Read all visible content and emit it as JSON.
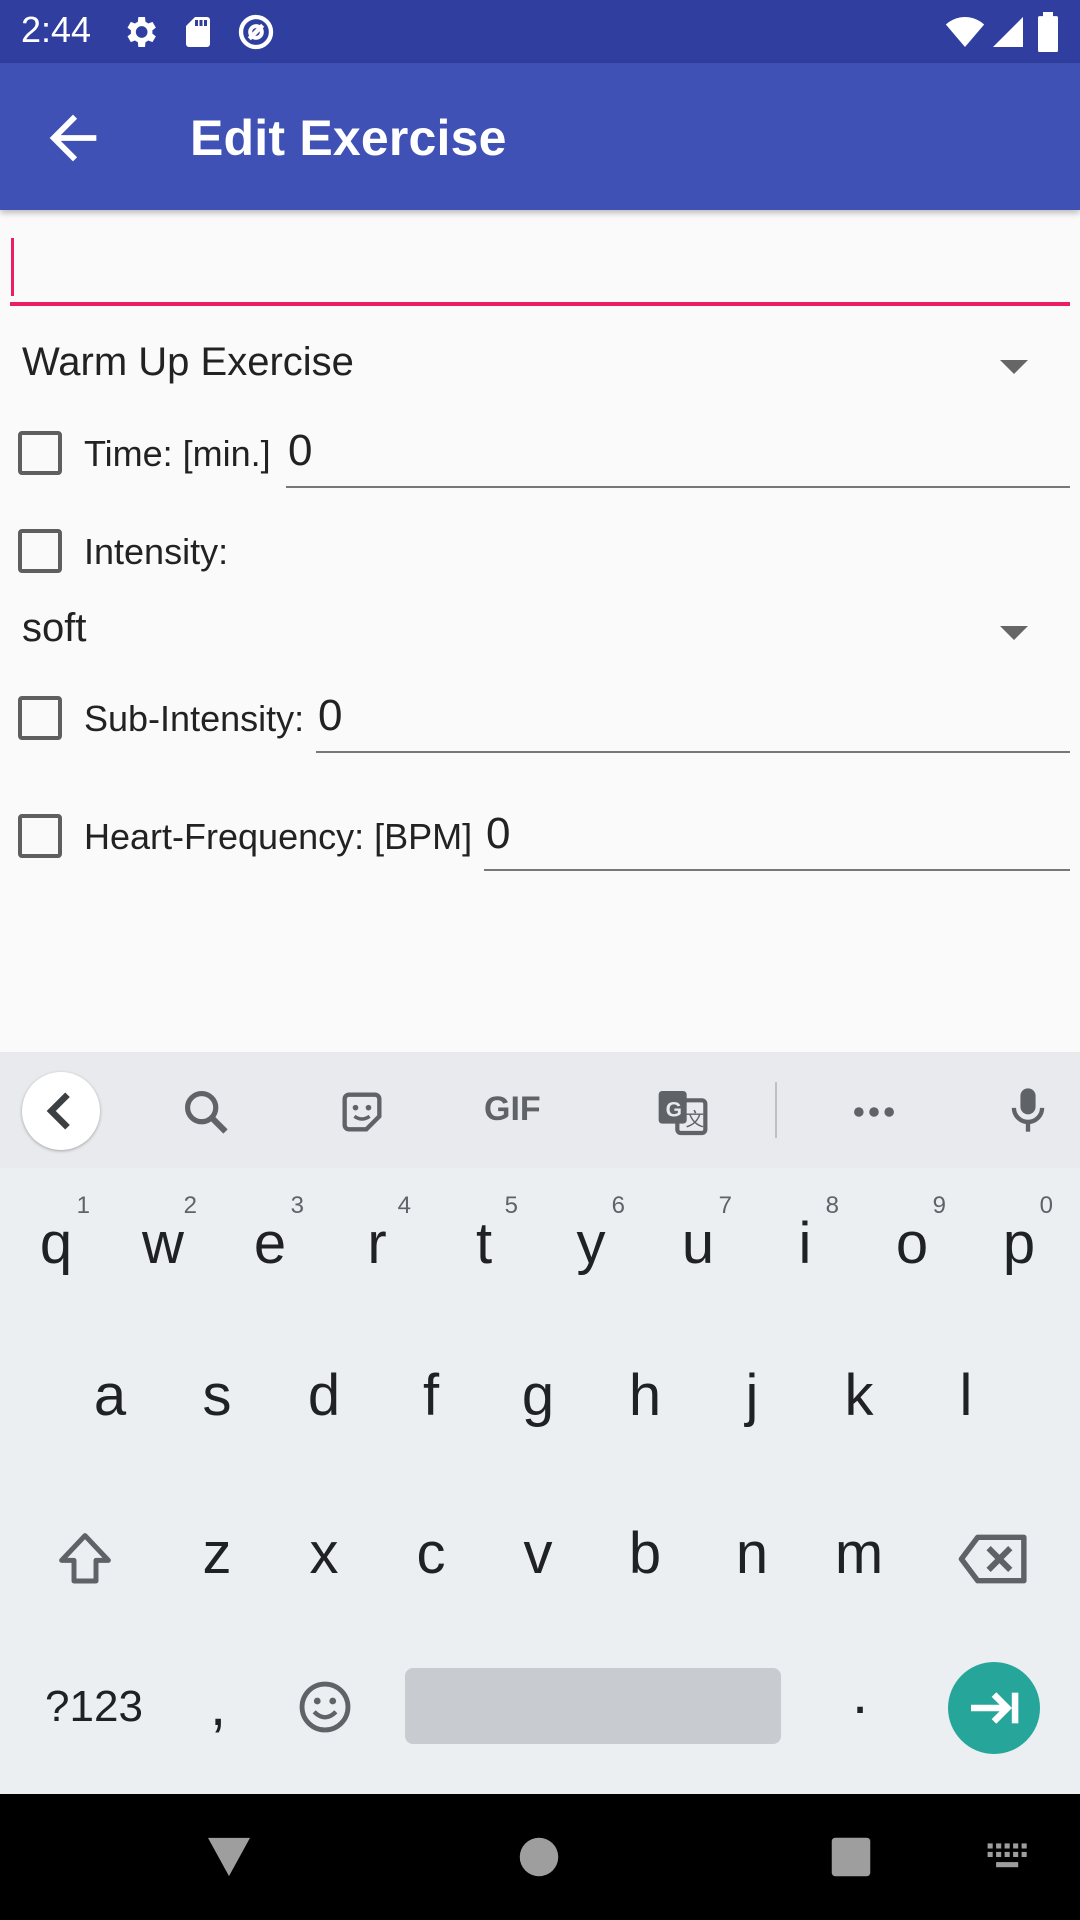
{
  "status_bar": {
    "time": "2:44",
    "left_icons": [
      "gear-icon",
      "sd-card-icon",
      "sync-icon"
    ],
    "right_icons": [
      "wifi-icon",
      "signal-icon",
      "battery-icon"
    ]
  },
  "app_bar": {
    "title": "Edit Exercise",
    "back_icon": "arrow-left-icon"
  },
  "form": {
    "name_input": {
      "value": "",
      "placeholder": ""
    },
    "exercise_type": {
      "selected": "Warm Up Exercise"
    },
    "time": {
      "label": "Time: [min.]",
      "value": "0",
      "checked": false
    },
    "intensity": {
      "label": "Intensity:",
      "checked": false,
      "selected": "soft"
    },
    "sub_intensity": {
      "label": "Sub-Intensity:",
      "value": "0",
      "checked": false
    },
    "heart_frequency": {
      "label": "Heart-Frequency: [BPM]",
      "value": "0",
      "checked": false
    }
  },
  "keyboard": {
    "toolbar": {
      "gif_label": "GIF",
      "icons": [
        "chevron-left-icon",
        "search-icon",
        "sticker-icon",
        "gif-icon",
        "translate-icon",
        "more-icon",
        "mic-icon"
      ]
    },
    "row1": [
      "q",
      "w",
      "e",
      "r",
      "t",
      "y",
      "u",
      "i",
      "o",
      "p"
    ],
    "row1_hints": [
      "1",
      "2",
      "3",
      "4",
      "5",
      "6",
      "7",
      "8",
      "9",
      "0"
    ],
    "row2": [
      "a",
      "s",
      "d",
      "f",
      "g",
      "h",
      "j",
      "k",
      "l"
    ],
    "row3": [
      "z",
      "x",
      "c",
      "v",
      "b",
      "n",
      "m"
    ],
    "symbols_label": "?123",
    "comma": ",",
    "period": ".",
    "colors": {
      "enter": "#26a69a",
      "accent": "#e91e63",
      "app_bar": "#3f51b5",
      "status_bar": "#303f9f"
    }
  },
  "nav_bar": {
    "icons": [
      "back-triangle-icon",
      "home-circle-icon",
      "recents-square-icon",
      "keyboard-switch-icon"
    ]
  }
}
